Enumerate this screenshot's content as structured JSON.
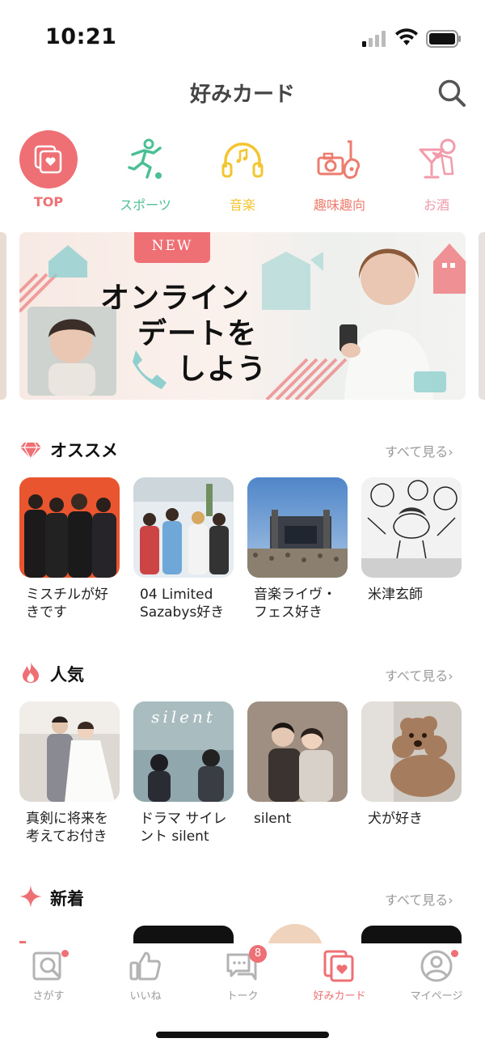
{
  "status": {
    "time": "10:21"
  },
  "header": {
    "title": "好みカード"
  },
  "categories": [
    {
      "label": "TOP",
      "color": "#ee6f74",
      "icon": "cards-heart-icon"
    },
    {
      "label": "スポーツ",
      "color": "#4dbf94",
      "icon": "soccer-player-icon"
    },
    {
      "label": "音楽",
      "color": "#f2c531",
      "icon": "headphones-icon"
    },
    {
      "label": "趣味趣向",
      "color": "#ee7c6e",
      "icon": "camera-guitar-icon"
    },
    {
      "label": "お酒",
      "color": "#f19bab",
      "icon": "cocktail-icon"
    }
  ],
  "banner": {
    "badge": "NEW",
    "line1": "オンライン",
    "line2": "デートを",
    "line3": "しよう"
  },
  "sections": {
    "recommended": {
      "title": "オススメ",
      "see_all": "すべて見る",
      "cards": [
        {
          "label": "ミスチルが好きです"
        },
        {
          "label": "04 Limited Sazabys好き"
        },
        {
          "label": "音楽ライヴ・フェス好き"
        },
        {
          "label": "米津玄師"
        }
      ]
    },
    "popular": {
      "title": "人気",
      "see_all": "すべて見る",
      "cards": [
        {
          "label": "真剣に将来を考えてお付き"
        },
        {
          "label": "ドラマ サイレント silent"
        },
        {
          "label": "silent"
        },
        {
          "label": "犬が好き"
        }
      ]
    },
    "new": {
      "title": "新着",
      "see_all": "すべて見る"
    }
  },
  "tabbar": {
    "items": [
      {
        "label": "さがす",
        "active": false
      },
      {
        "label": "いいね",
        "active": false
      },
      {
        "label": "トーク",
        "active": false,
        "badge": "8"
      },
      {
        "label": "好みカード",
        "active": true
      },
      {
        "label": "マイページ",
        "active": false
      }
    ]
  },
  "colors": {
    "accent": "#ee6f74",
    "muted": "#9a9a9a"
  }
}
